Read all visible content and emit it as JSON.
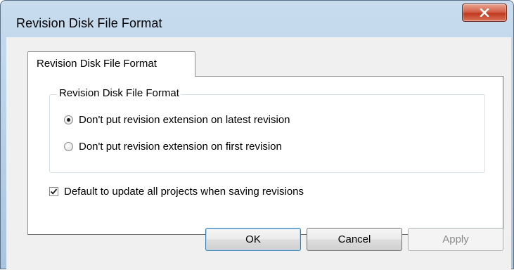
{
  "window": {
    "title": "Revision Disk File Format",
    "close_icon": "close-icon"
  },
  "tabs": [
    {
      "label": "Revision Disk File Format",
      "selected": true
    }
  ],
  "group": {
    "legend": "Revision Disk File Format",
    "options": [
      {
        "label": "Don't put revision extension on latest revision",
        "checked": true
      },
      {
        "label": "Don't put revision extension on first revision",
        "checked": false
      }
    ]
  },
  "checkbox": {
    "label": "Default to update all projects when saving revisions",
    "checked": true
  },
  "buttons": {
    "ok": "OK",
    "cancel": "Cancel",
    "apply": "Apply"
  },
  "colors": {
    "close_button": "#c0391f",
    "default_button_border": "#3c7fb1"
  }
}
